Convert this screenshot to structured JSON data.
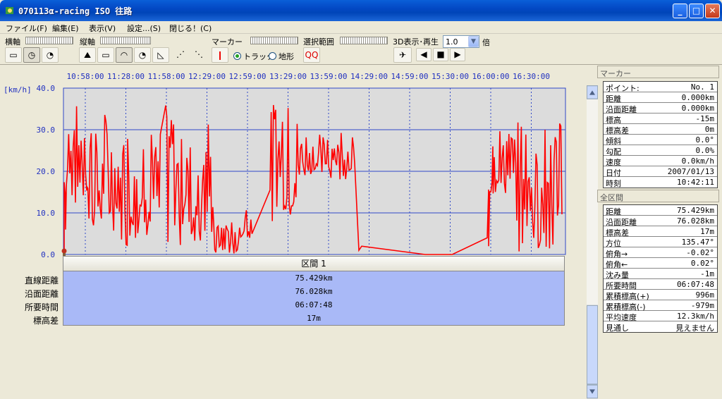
{
  "window": {
    "title": "070113α-racing ISO 往路"
  },
  "menu": [
    "ファイル(F)",
    "編集(E)",
    "表示(V)",
    "設定...(S)",
    "閉じる！(C)"
  ],
  "toolbar": {
    "hjiku": "横軸",
    "tjiku": "縦軸",
    "marker": "マーカー",
    "sentaku": "選択範囲",
    "display3d": "3D表示･再生",
    "speed_value": "1.0",
    "bai": "倍",
    "radio_track": "トラック",
    "radio_terrain": "地形"
  },
  "chart_data": {
    "type": "line",
    "ylabel": "[km/h]",
    "yticks": [
      "40.0",
      "30.0",
      "20.0",
      "10.0",
      "0.0"
    ],
    "ylim": [
      0,
      40
    ],
    "xticks": [
      "10:58:00",
      "11:28:00",
      "11:58:00",
      "12:29:00",
      "12:59:00",
      "13:29:00",
      "13:59:00",
      "14:29:00",
      "14:59:00",
      "15:30:00",
      "16:00:00",
      "16:30:00"
    ],
    "series": [
      {
        "color": "#ff0000",
        "note": "speed profile"
      }
    ]
  },
  "stats": {
    "section_header": "区間 1",
    "labels": [
      "直線距離",
      "沿面距離",
      "所要時間",
      "標高差"
    ],
    "values": [
      "75.429km",
      "76.028km",
      "06:07:48",
      "17m"
    ]
  },
  "marker_panel": {
    "header": "マーカー",
    "rows": [
      [
        "ポイント:",
        "No. 1"
      ],
      [
        "距離",
        "0.000km"
      ],
      [
        "沿面距離",
        "0.000km"
      ],
      [
        "標高",
        "-15m"
      ],
      [
        "標高差",
        "0m"
      ],
      [
        "傾斜",
        "0.0°"
      ],
      [
        "勾配",
        "0.0%"
      ],
      [
        "速度",
        "0.0km/h"
      ],
      [
        "日付",
        "2007/01/13"
      ],
      [
        "時刻",
        "10:42:11"
      ]
    ]
  },
  "total_panel": {
    "header": "全区間",
    "rows": [
      [
        "距離",
        "75.429km"
      ],
      [
        "沿面距離",
        "76.028km"
      ],
      [
        "標高差",
        "17m"
      ],
      [
        "方位",
        "135.47°"
      ],
      [
        "俯角→",
        "-0.02°"
      ],
      [
        "俯角←",
        "0.02°"
      ],
      [
        "沈み量",
        "-1m"
      ],
      [
        "所要時間",
        "06:07:48"
      ],
      [
        "累積標高(+)",
        "996m"
      ],
      [
        "累積標高(-)",
        "-979m"
      ],
      [
        "平均速度",
        "12.3km/h"
      ],
      [
        "見通し",
        "見えません"
      ]
    ]
  },
  "colors": {
    "plot_bg": "#dcdcdc",
    "grid": "#3048c8",
    "line": "#ff0000",
    "stats_bg": "#a9b9f7"
  }
}
